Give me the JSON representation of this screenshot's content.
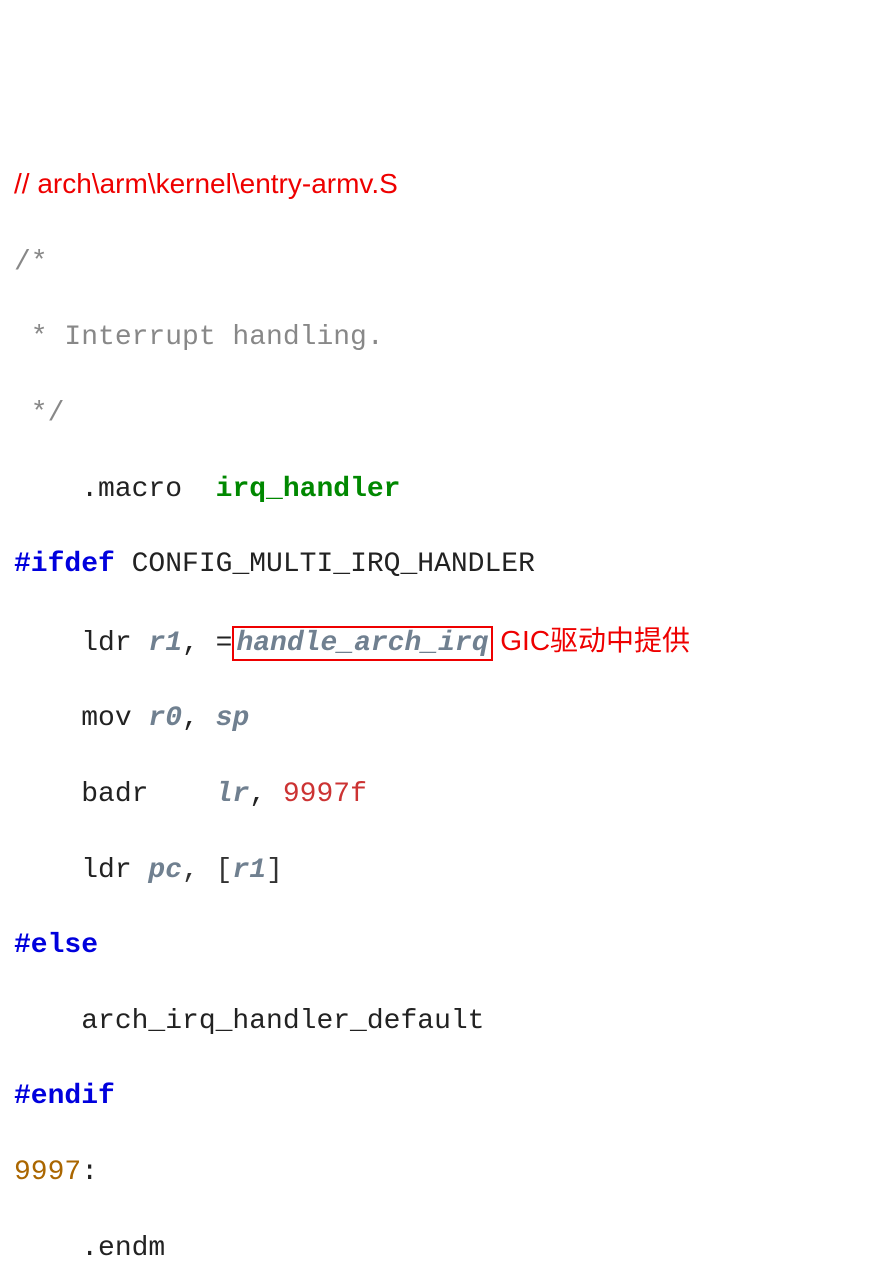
{
  "title_comment": "// arch\\arm\\kernel\\entry-armv.S",
  "block_comment": {
    "l1": "/*",
    "l2": " * Interrupt handling.",
    "l3": " */"
  },
  "macro_kw": "    .macro  ",
  "macro_name": "irq_handler",
  "ifdef": "#ifdef",
  "ifdef_cond": " CONFIG_MULTI_IRQ_HANDLER",
  "ldr1_pre": "    ldr ",
  "r1": "r1",
  "ldr1_sep": ", =",
  "handle_arch": "handle_arch_irq",
  "annotation": " GIC驱动中提供",
  "mov_pre": "    mov ",
  "r0": "r0",
  "mov_sep": ", ",
  "sp": "sp",
  "badr_pre": "    badr    ",
  "lr": "lr",
  "badr_sep": ", ",
  "badr_target": "9997f",
  "ldr2_pre": "    ldr ",
  "pc": "pc",
  "ldr2_sep": ", [",
  "ldr2_close": "]",
  "else_kw": "#else",
  "default_line": "    arch_irq_handler_default",
  "endif_kw": "#endif",
  "label_num": "9997",
  "label_colon": ":",
  "endm": "    .endm"
}
